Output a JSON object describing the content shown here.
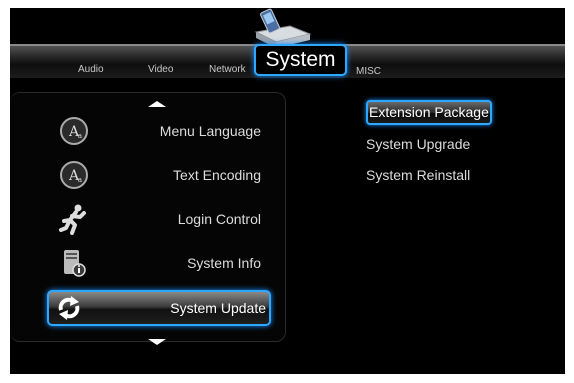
{
  "header": {
    "tabs": [
      {
        "label": "Audio"
      },
      {
        "label": "Video"
      },
      {
        "label": "Network"
      },
      {
        "label": "System"
      },
      {
        "label": "MISC"
      }
    ]
  },
  "menu": {
    "items": [
      {
        "label": "Menu Language",
        "icon": "language-icon"
      },
      {
        "label": "Text Encoding",
        "icon": "text-encoding-icon"
      },
      {
        "label": "Login Control",
        "icon": "running-man-icon"
      },
      {
        "label": "System Info",
        "icon": "system-info-icon"
      },
      {
        "label": "System Update",
        "icon": "refresh-icon"
      }
    ],
    "selected_index": 4
  },
  "submenu": {
    "items": [
      {
        "label": "Extension Package"
      },
      {
        "label": "System Upgrade"
      },
      {
        "label": "System Reinstall"
      }
    ],
    "selected_index": 0
  },
  "colors": {
    "highlight": "#2ea8ff",
    "background": "#000000",
    "text": "#dcdcdc"
  }
}
